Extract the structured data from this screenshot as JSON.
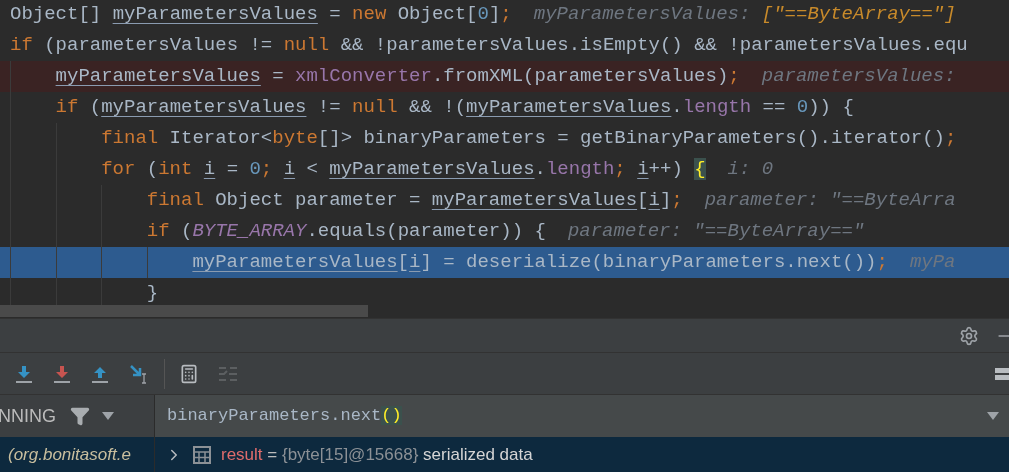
{
  "editor": {
    "lines": [
      {
        "breakpoint": false,
        "execution": false,
        "tokens": [
          {
            "text": "Object[] ",
            "kind": "plain"
          },
          {
            "text": "myParametersValues",
            "kind": "var"
          },
          {
            "text": " = ",
            "kind": "plain"
          },
          {
            "text": "new",
            "kind": "keyword"
          },
          {
            "text": " Object[",
            "kind": "plain"
          },
          {
            "text": "0",
            "kind": "number"
          },
          {
            "text": "]",
            "kind": "plain"
          },
          {
            "text": ";",
            "kind": "keyword"
          }
        ],
        "hints": [
          {
            "text": "myParametersValues: ",
            "changed": false
          },
          {
            "text": "[\"==ByteArray==\"]",
            "changed": true
          }
        ]
      },
      {
        "breakpoint": false,
        "execution": false,
        "tokens": [
          {
            "text": "if",
            "kind": "keyword"
          },
          {
            "text": " (parametersValues != ",
            "kind": "plain"
          },
          {
            "text": "null",
            "kind": "keyword"
          },
          {
            "text": " && !parametersValues.isEmpty() && !parametersValues.equ",
            "kind": "plain"
          }
        ],
        "children": [
          {
            "breakpoint": true,
            "execution": false,
            "tokens": [
              {
                "text": "myParametersValues",
                "kind": "var"
              },
              {
                "text": " = ",
                "kind": "plain"
              },
              {
                "text": "xmlConverter",
                "kind": "field"
              },
              {
                "text": ".fromXML(parametersValues)",
                "kind": "plain"
              },
              {
                "text": ";",
                "kind": "keyword"
              }
            ],
            "hints": [
              {
                "text": "parametersValues:",
                "changed": false
              }
            ]
          },
          {
            "breakpoint": false,
            "execution": false,
            "tokens": [
              {
                "text": "if",
                "kind": "keyword"
              },
              {
                "text": " (",
                "kind": "plain"
              },
              {
                "text": "myParametersValues",
                "kind": "var"
              },
              {
                "text": " != ",
                "kind": "plain"
              },
              {
                "text": "null",
                "kind": "keyword"
              },
              {
                "text": " && !(",
                "kind": "plain"
              },
              {
                "text": "myParametersValues",
                "kind": "var"
              },
              {
                "text": ".",
                "kind": "plain"
              },
              {
                "text": "length",
                "kind": "field"
              },
              {
                "text": " == ",
                "kind": "plain"
              },
              {
                "text": "0",
                "kind": "number"
              },
              {
                "text": ")) {",
                "kind": "plain"
              }
            ],
            "children": [
              {
                "breakpoint": false,
                "execution": false,
                "tokens": [
                  {
                    "text": "final",
                    "kind": "keyword"
                  },
                  {
                    "text": " Iterator<",
                    "kind": "plain"
                  },
                  {
                    "text": "byte",
                    "kind": "keyword"
                  },
                  {
                    "text": "[]> binaryParameters = getBinaryParameters().iterator()",
                    "kind": "plain"
                  },
                  {
                    "text": ";",
                    "kind": "keyword"
                  }
                ]
              },
              {
                "breakpoint": false,
                "execution": false,
                "tokens": [
                  {
                    "text": "for",
                    "kind": "keyword"
                  },
                  {
                    "text": " (",
                    "kind": "plain"
                  },
                  {
                    "text": "int ",
                    "kind": "keyword"
                  },
                  {
                    "text": "i",
                    "kind": "var"
                  },
                  {
                    "text": " = ",
                    "kind": "plain"
                  },
                  {
                    "text": "0",
                    "kind": "number"
                  },
                  {
                    "text": "; ",
                    "kind": "keyword"
                  },
                  {
                    "text": "i",
                    "kind": "var"
                  },
                  {
                    "text": " < ",
                    "kind": "plain"
                  },
                  {
                    "text": "myParametersValues",
                    "kind": "var"
                  },
                  {
                    "text": ".",
                    "kind": "plain"
                  },
                  {
                    "text": "length",
                    "kind": "field"
                  },
                  {
                    "text": "; ",
                    "kind": "keyword"
                  },
                  {
                    "text": "i",
                    "kind": "var"
                  },
                  {
                    "text": "++) ",
                    "kind": "plain"
                  },
                  {
                    "text": "{",
                    "kind": "brace"
                  }
                ],
                "hints": [
                  {
                    "text": "i: 0",
                    "changed": false
                  }
                ],
                "children": [
                  {
                    "breakpoint": false,
                    "execution": false,
                    "tokens": [
                      {
                        "text": "final",
                        "kind": "keyword"
                      },
                      {
                        "text": " Object parameter = ",
                        "kind": "plain"
                      },
                      {
                        "text": "myParametersValues",
                        "kind": "var"
                      },
                      {
                        "text": "[",
                        "kind": "plain"
                      },
                      {
                        "text": "i",
                        "kind": "var"
                      },
                      {
                        "text": "]",
                        "kind": "plain"
                      },
                      {
                        "text": ";",
                        "kind": "keyword"
                      }
                    ],
                    "hints": [
                      {
                        "text": "parameter: \"==ByteArra",
                        "changed": false
                      }
                    ]
                  },
                  {
                    "breakpoint": false,
                    "execution": false,
                    "tokens": [
                      {
                        "text": "if",
                        "kind": "keyword"
                      },
                      {
                        "text": " (",
                        "kind": "plain"
                      },
                      {
                        "text": "BYTE_ARRAY",
                        "kind": "constant"
                      },
                      {
                        "text": ".equals(parameter)) {",
                        "kind": "plain"
                      }
                    ],
                    "hints": [
                      {
                        "text": "parameter: \"==ByteArray==\"",
                        "changed": false
                      }
                    ],
                    "children": [
                      {
                        "breakpoint": false,
                        "execution": true,
                        "tokens": [
                          {
                            "text": "myParametersValues",
                            "kind": "var"
                          },
                          {
                            "text": "[",
                            "kind": "plain"
                          },
                          {
                            "text": "i",
                            "kind": "var"
                          },
                          {
                            "text": "] = deserialize(binaryParameters.next())",
                            "kind": "plain"
                          },
                          {
                            "text": ";",
                            "kind": "keyword"
                          }
                        ],
                        "hints": [
                          {
                            "text": "myPa",
                            "changed": false
                          }
                        ]
                      }
                    ]
                  },
                  {
                    "breakpoint": false,
                    "execution": false,
                    "tokens": [
                      {
                        "text": "}",
                        "kind": "plain"
                      }
                    ]
                  }
                ]
              }
            ]
          }
        ]
      }
    ]
  },
  "debugger": {
    "frames_filter": {
      "label": "NNING"
    },
    "frames": [
      {
        "text": "(org.bonitasoft.e",
        "selected": true
      }
    ],
    "expression": {
      "tokens": [
        {
          "text": "binaryParameters.next",
          "kind": "plain"
        },
        {
          "text": "()",
          "kind": "brace"
        }
      ]
    },
    "variables": [
      {
        "name": "result",
        "equals": " = ",
        "type": "{byte[15]@15668}",
        "value": " serialized data",
        "selected": true
      }
    ]
  }
}
